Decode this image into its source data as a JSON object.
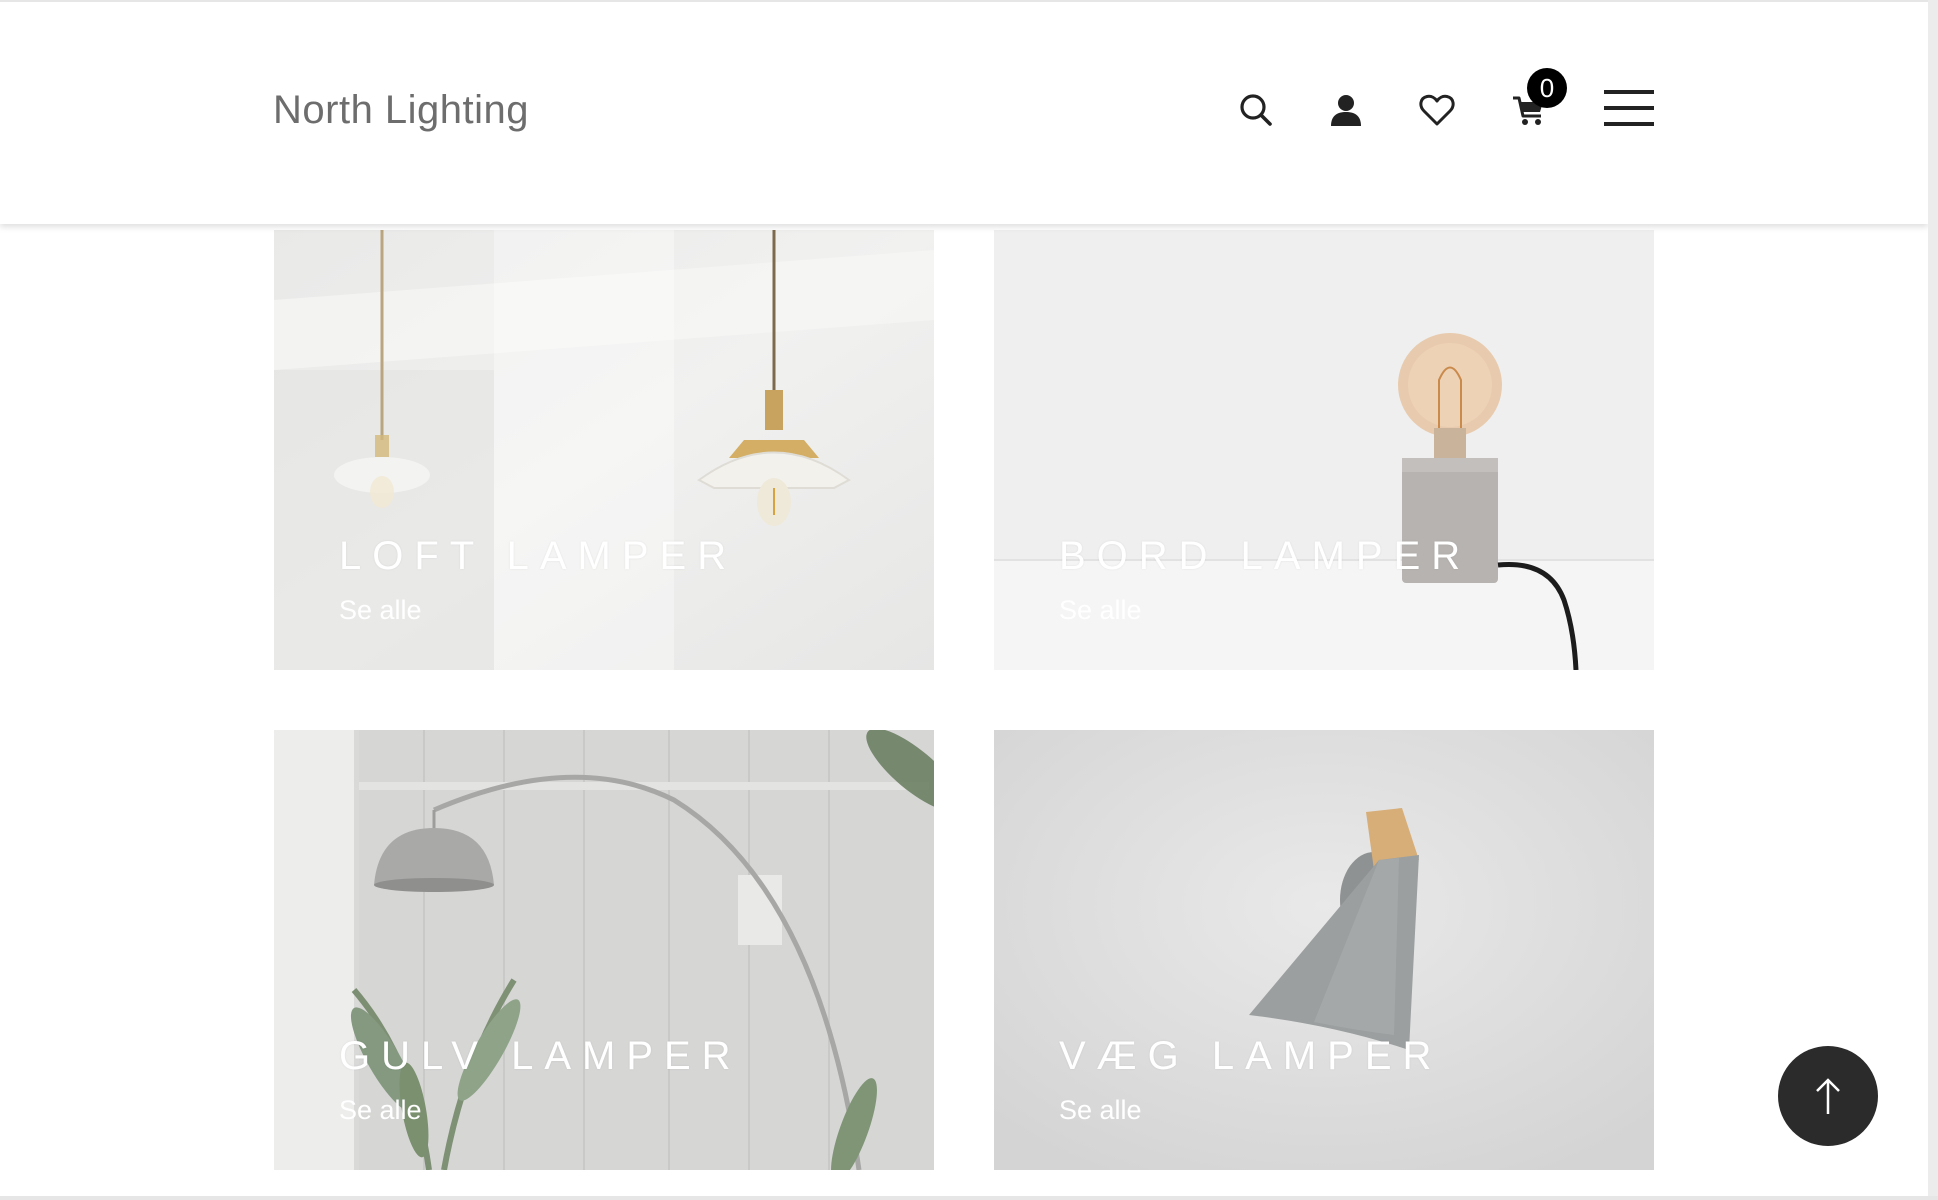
{
  "header": {
    "brand": "North Lighting",
    "icons": [
      "search-icon",
      "account-icon",
      "heart-icon",
      "cart-icon",
      "menu-icon"
    ],
    "cart_count": "0"
  },
  "categories": [
    {
      "title": "LOFT LAMPER",
      "link": "Se alle"
    },
    {
      "title": "BORD LAMPER",
      "link": "Se alle"
    },
    {
      "title": "GULV LAMPER",
      "link": "Se alle"
    },
    {
      "title": "VÆG LAMPER",
      "link": "Se alle"
    }
  ],
  "scroll_top": {
    "icon": "arrow-up-icon"
  },
  "colors": {
    "brand_text": "#6d6d6d",
    "badge_bg": "#000000",
    "scroll_button_bg": "#2b2b2b"
  }
}
